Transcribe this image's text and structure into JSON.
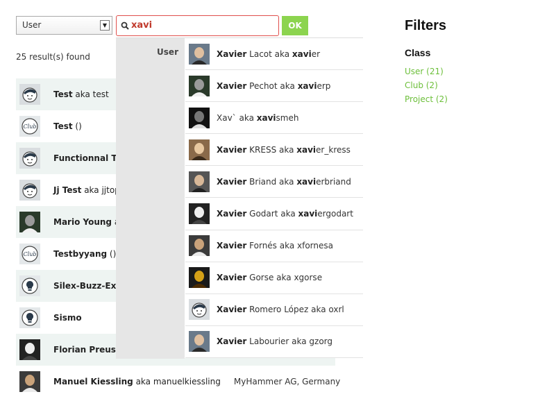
{
  "search": {
    "scope_value": "User",
    "query": "xavi",
    "ok_label": "OK"
  },
  "results": {
    "count_text": "25 result(s) found",
    "rows": [
      {
        "name": "Test",
        "alias": " aka test",
        "extra": "",
        "avatar": "user-avatar"
      },
      {
        "name": "Test",
        "alias": " ()",
        "extra": "",
        "avatar": "club-avatar"
      },
      {
        "name": "Functionnal Te",
        "alias": "",
        "extra": "",
        "avatar": "user-avatar"
      },
      {
        "name": "Jj Test",
        "alias": " aka jjtop",
        "extra": "",
        "avatar": "user-avatar"
      },
      {
        "name": "Mario Young",
        "alias": " ak",
        "extra": "",
        "avatar": "photo-avatar"
      },
      {
        "name": "Testbyyang",
        "alias": " ()",
        "extra": "",
        "avatar": "club-avatar"
      },
      {
        "name": "Silex-Buzz-Ext",
        "alias": "",
        "extra": "",
        "avatar": "project-avatar"
      },
      {
        "name": "Sismo",
        "alias": "",
        "extra": "",
        "avatar": "project-avatar"
      },
      {
        "name": "Florian Preusne",
        "alias": "",
        "extra": "",
        "avatar": "photo-avatar"
      },
      {
        "name": "Manuel Kiessling",
        "alias": " aka manuelkiessling",
        "extra": "MyHammer AG, Germany",
        "avatar": "photo-avatar"
      }
    ]
  },
  "dropdown": {
    "section_label": "User",
    "items": [
      {
        "pre_bold": "Xavier",
        "mid": " Lacot aka ",
        "match": "xavi",
        "post": "er",
        "avatar": "photo-avatar"
      },
      {
        "pre_bold": "Xavier",
        "mid": " Pechot aka ",
        "match": "xavi",
        "post": "erp",
        "avatar": "photo-avatar"
      },
      {
        "pre_bold": "",
        "mid": "Xav` aka ",
        "match": "xavi",
        "post": "smeh",
        "avatar": "photo-avatar"
      },
      {
        "pre_bold": "Xavier",
        "mid": " KRESS aka ",
        "match": "xavi",
        "post": "er_kress",
        "avatar": "photo-avatar"
      },
      {
        "pre_bold": "Xavier",
        "mid": " Briand aka ",
        "match": "xavi",
        "post": "erbriand",
        "avatar": "photo-avatar"
      },
      {
        "pre_bold": "Xavier",
        "mid": " Godart aka ",
        "match": "xavi",
        "post": "ergodart",
        "avatar": "photo-avatar"
      },
      {
        "pre_bold": "Xavier",
        "mid": " Fornés aka xfornesa",
        "match": "",
        "post": "",
        "avatar": "photo-avatar"
      },
      {
        "pre_bold": "Xavier",
        "mid": " Gorse aka xgorse",
        "match": "",
        "post": "",
        "avatar": "photo-avatar"
      },
      {
        "pre_bold": "Xavier",
        "mid": " Romero López aka oxrl",
        "match": "",
        "post": "",
        "avatar": "user-avatar"
      },
      {
        "pre_bold": "Xavier",
        "mid": " Labourier aka gzorg",
        "match": "",
        "post": "",
        "avatar": "photo-avatar"
      }
    ]
  },
  "filters": {
    "title": "Filters",
    "class_heading": "Class",
    "links": [
      "User (21)",
      "Club (2)",
      "Project (2)"
    ]
  },
  "colors": {
    "accent_green": "#8cd44f",
    "link_green": "#6cbf3a",
    "search_border": "#e0504c",
    "alt_row": "#eef4f2"
  }
}
